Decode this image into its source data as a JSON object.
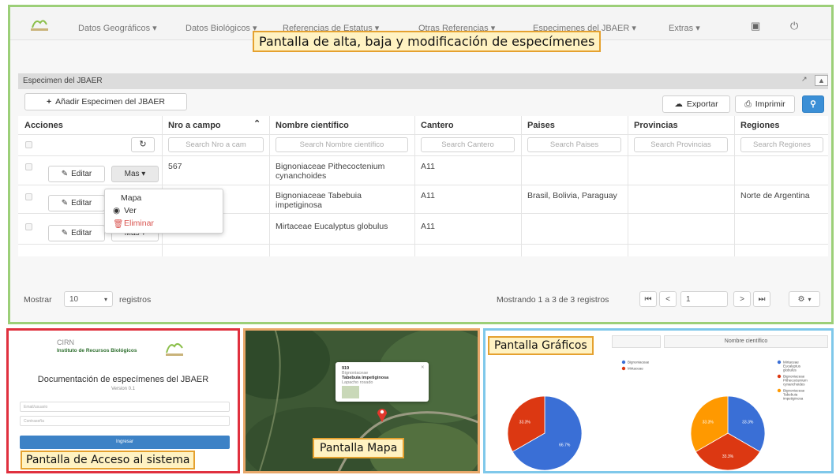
{
  "navbar": {
    "menus": [
      "Datos Geográficos ▾",
      "Datos Biológicos ▾",
      "Referencias de Estatus ▾",
      "Otras Referencias ▾",
      "Especimenes del JBAER ▾",
      "Extras ▾"
    ]
  },
  "callouts": {
    "top": "Pantalla de alta, baja y modificación de especímenes",
    "login": "Pantalla de Acceso al sistema",
    "map": "Pantalla Mapa",
    "chart": "Pantalla Gráficos"
  },
  "section": {
    "title": "Especimen del JBAER"
  },
  "toolbar": {
    "add_label": "Añadir Especimen del JBAER",
    "export_label": "Exportar",
    "print_label": "Imprimir"
  },
  "table": {
    "headers": [
      "Acciones",
      "Nro a campo",
      "Nombre científico",
      "Cantero",
      "Paises",
      "Provincias",
      "Regiones"
    ],
    "placeholders": [
      "Search Nro a cam",
      "Search Nombre científico",
      "Search Cantero",
      "Search Paises",
      "Search Provincias",
      "Search Regiones"
    ],
    "edit_label": "Editar",
    "more_label": "Mas ▾",
    "rows": [
      {
        "nro": "567",
        "nombre": "Bignoniaceae Pithecoctenium cynanchoides",
        "cantero": "A11",
        "paises": "",
        "provincias": "",
        "regiones": ""
      },
      {
        "nro": "",
        "nombre": "Bignoniaceae Tabebuia impetiginosa",
        "cantero": "A11",
        "paises": "Brasil, Bolivia, Paraguay",
        "provincias": "",
        "regiones": "Norte de Argentina"
      },
      {
        "nro": "",
        "nombre": "Mirtaceae Eucalyptus globulus",
        "cantero": "A11",
        "paises": "",
        "provincias": "",
        "regiones": ""
      }
    ]
  },
  "dropdown": {
    "items": [
      "Mapa",
      "Ver",
      "Eliminar"
    ]
  },
  "footer": {
    "show_label": "Mostrar",
    "page_size": "10",
    "records_label": "registros",
    "summary": "Mostrando 1 a 3 de 3 registros",
    "page": "1"
  },
  "login": {
    "logo_line1": "CIRN",
    "logo_line2": "Instituto de Recursos Biológicos",
    "title": "Documentación de especímenes del JBAER",
    "version": "Version 0.1",
    "user_placeholder": "Email/usuario",
    "pass_placeholder": "Contraseña",
    "button": "Ingresar"
  },
  "map": {
    "popup_id": "919",
    "popup_family": "Bignoniaceae",
    "popup_species": "Tabebuia impetiginosa",
    "popup_common": "Lapacho rosado"
  },
  "charts": {
    "tab_right": "Nombre científico"
  },
  "chart_data": [
    {
      "type": "pie",
      "labels": [
        "Bignoniaceae",
        "Mirtaceae"
      ],
      "values": [
        66.7,
        33.3
      ],
      "colors": [
        "#3a6fd6",
        "#dc3812"
      ]
    },
    {
      "type": "pie",
      "title": "Nombre científico",
      "labels": [
        "Mirtaceae Eucalyptus globulus",
        "Bignoniaceae Pithecoctenium cynanchoides",
        "Bignoniaceae Tabebuia impetiginosa"
      ],
      "values": [
        33.3,
        33.3,
        33.3
      ],
      "colors": [
        "#3a6fd6",
        "#dc3812",
        "#ff9900"
      ]
    }
  ]
}
